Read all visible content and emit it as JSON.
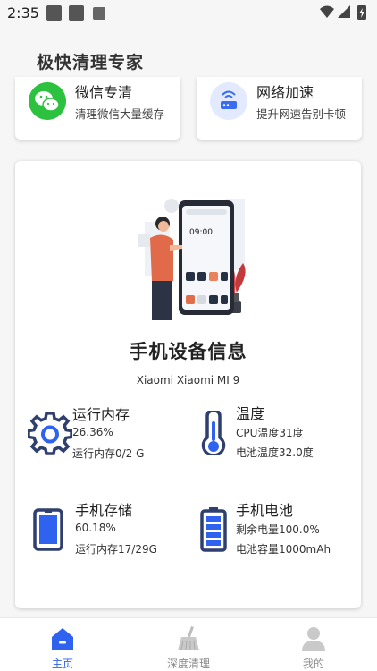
{
  "status_bar": {
    "time": "2:35"
  },
  "app": {
    "title": "极快清理专家"
  },
  "quick_cards": [
    {
      "title": "微信专清",
      "subtitle": "清理微信大量缓存",
      "icon": "wechat-icon"
    },
    {
      "title": "网络加速",
      "subtitle": "提升网速告别卡顿",
      "icon": "router-icon"
    }
  ],
  "device": {
    "title": "手机设备信息",
    "model": "Xiaomi Xiaomi MI 9",
    "illustration_time": "09:00"
  },
  "info": {
    "memory": {
      "title": "运行内存",
      "line1": "26.36%",
      "line2": "运行内存0/2 G",
      "icon": "gear-icon"
    },
    "temperature": {
      "title": "温度",
      "line1": "CPU温度31度",
      "line2": "电池温度32.0度",
      "icon": "thermometer-icon"
    },
    "storage": {
      "title": "手机存储",
      "line1": "60.18%",
      "line2": "运行内存17/29G",
      "icon": "phone-icon"
    },
    "battery": {
      "title": "手机电池",
      "line1": "剩余电量100.0%",
      "line2": "电池容量1000mAh",
      "icon": "battery-icon"
    }
  },
  "tabs": [
    {
      "label": "主页",
      "icon": "home-icon",
      "active": true
    },
    {
      "label": "深度清理",
      "icon": "broom-icon",
      "active": false
    },
    {
      "label": "我的",
      "icon": "user-icon",
      "active": false
    }
  ],
  "colors": {
    "accent": "#2f63ef",
    "icon_navy": "#2f3f6e",
    "wechat_green": "#2cc23f"
  }
}
